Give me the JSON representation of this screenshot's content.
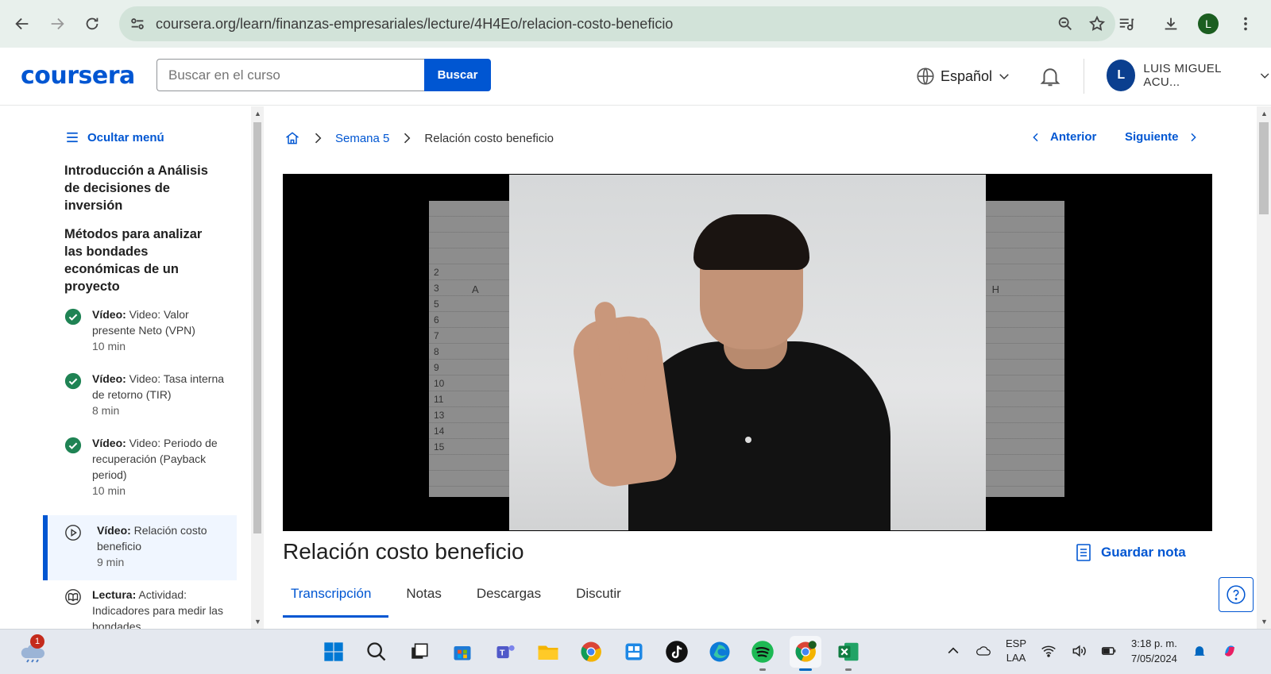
{
  "browser": {
    "url": "coursera.org/learn/finanzas-empresariales/lecture/4H4Eo/relacion-costo-beneficio",
    "profile_initial": "L"
  },
  "header": {
    "logo": "coursera",
    "search_placeholder": "Buscar en el curso",
    "search_button": "Buscar",
    "language": "Español",
    "user_initial": "L",
    "user_name": "LUIS MIGUEL ACU..."
  },
  "sidebar": {
    "hide_menu": "Ocultar menú",
    "module_titles": [
      "Introducción a Análisis de decisiones de inversión",
      "Métodos para analizar las bondades económicas de un proyecto"
    ],
    "lessons": [
      {
        "type": "Vídeo:",
        "title": "Video: Valor presente Neto (VPN)",
        "duration": "10 min",
        "status": "done"
      },
      {
        "type": "Vídeo:",
        "title": "Video: Tasa interna de retorno (TIR)",
        "duration": "8 min",
        "status": "done"
      },
      {
        "type": "Vídeo:",
        "title": "Video: Periodo de recuperación (Payback period)",
        "duration": "10 min",
        "status": "done"
      },
      {
        "type": "Vídeo:",
        "title": "Relación costo beneficio",
        "duration": "9 min",
        "status": "current"
      },
      {
        "type": "Lectura:",
        "title": "Actividad: Indicadores para medir las bondades",
        "duration": "",
        "status": "todo"
      }
    ]
  },
  "main": {
    "breadcrumb_week": "Semana 5",
    "breadcrumb_current": "Relación costo beneficio",
    "prev": "Anterior",
    "next": "Siguiente",
    "lecture_title": "Relación costo beneficio",
    "save_note": "Guardar nota",
    "tabs": [
      "Transcripción",
      "Notas",
      "Descargas",
      "Discutir"
    ],
    "active_tab": 0,
    "sheet_column_a": "A",
    "sheet_column_h": "H",
    "sheet_rows": [
      "2",
      "3",
      "5",
      "6",
      "7",
      "8",
      "9",
      "10",
      "11",
      "13",
      "14",
      "15"
    ]
  },
  "taskbar": {
    "weather_badge": "1",
    "lang_line1": "ESP",
    "lang_line2": "LAA",
    "time": "3:18 p. m.",
    "date": "7/05/2024"
  },
  "colors": {
    "brand": "#0056d2",
    "done": "#1f8354"
  }
}
